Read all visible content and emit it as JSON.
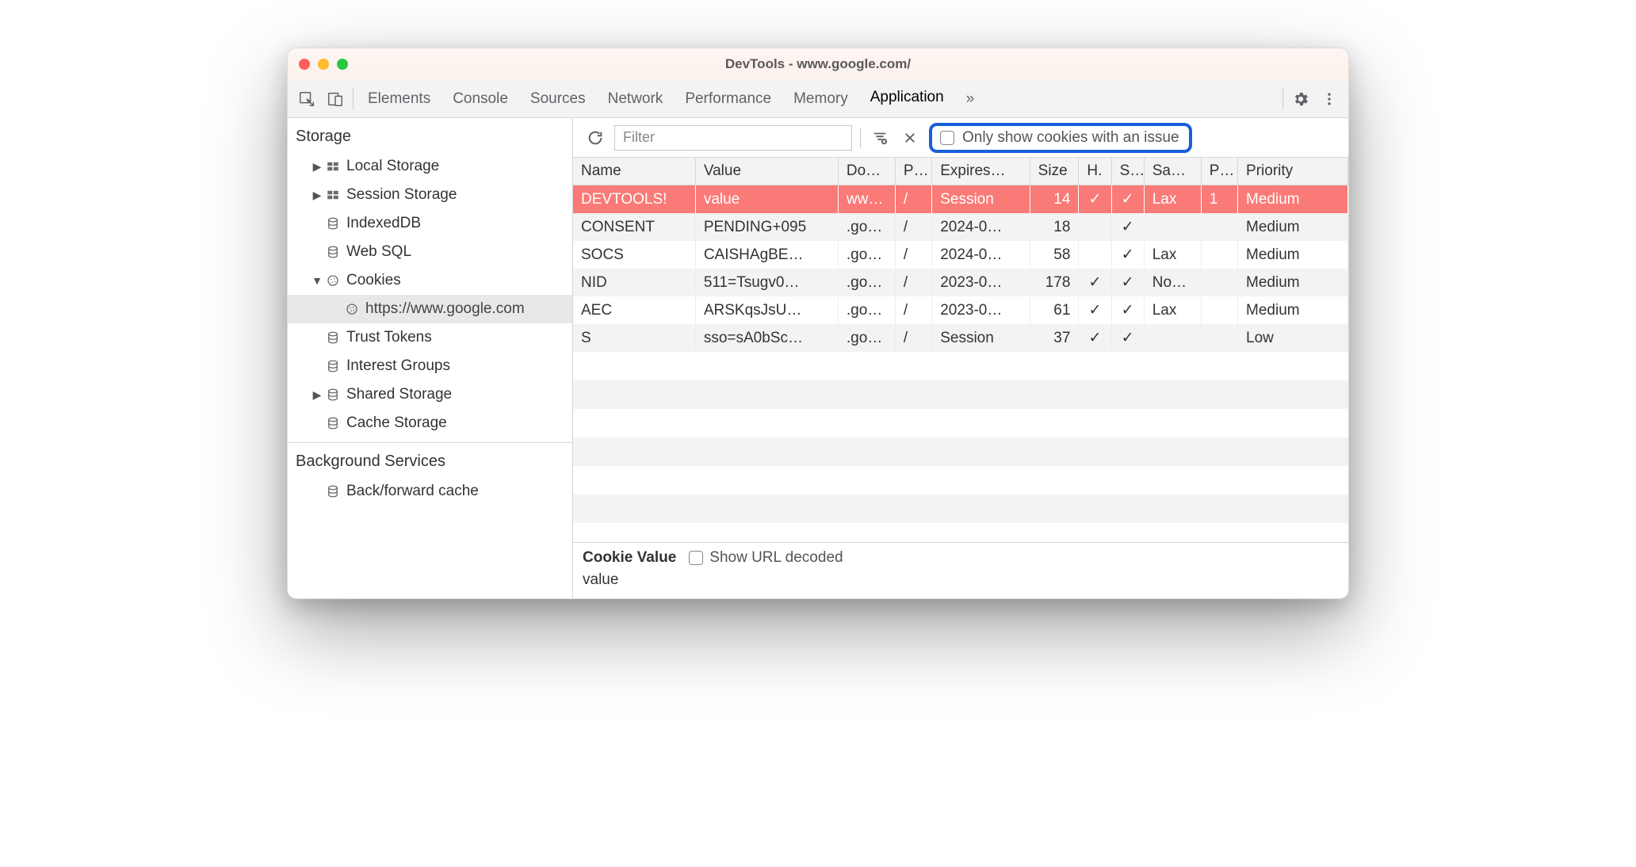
{
  "window": {
    "title": "DevTools - www.google.com/"
  },
  "tabs": {
    "items": [
      "Elements",
      "Console",
      "Sources",
      "Network",
      "Performance",
      "Memory",
      "Application"
    ],
    "active_index": 6,
    "overflow_glyph": "»"
  },
  "toolbar": {
    "filter_placeholder": "Filter",
    "only_issues_label": "Only show cookies with an issue",
    "only_issues_checked": false
  },
  "sidebar": {
    "storage_header": "Storage",
    "items": [
      {
        "label": "Local Storage",
        "icon": "grid",
        "caret": "closed"
      },
      {
        "label": "Session Storage",
        "icon": "grid",
        "caret": "closed"
      },
      {
        "label": "IndexedDB",
        "icon": "db",
        "caret": "none"
      },
      {
        "label": "Web SQL",
        "icon": "db",
        "caret": "none"
      },
      {
        "label": "Cookies",
        "icon": "cookie",
        "caret": "open"
      },
      {
        "label": "https://www.google.com",
        "icon": "cookie",
        "caret": "none",
        "indent": 2,
        "selected": true
      },
      {
        "label": "Trust Tokens",
        "icon": "db",
        "caret": "none"
      },
      {
        "label": "Interest Groups",
        "icon": "db",
        "caret": "none"
      },
      {
        "label": "Shared Storage",
        "icon": "db",
        "caret": "closed"
      },
      {
        "label": "Cache Storage",
        "icon": "db",
        "caret": "none"
      }
    ],
    "bg_header": "Background Services",
    "bg_items": [
      {
        "label": "Back/forward cache",
        "icon": "db"
      }
    ]
  },
  "table": {
    "columns": [
      "Name",
      "Value",
      "Do…",
      "P…",
      "Expires…",
      "Size",
      "H.",
      "S…",
      "Sa…",
      "P…",
      "Priority"
    ],
    "rows": [
      {
        "highlight": true,
        "name": "DEVTOOLS!",
        "value": "value",
        "domain": "ww…",
        "path": "/",
        "expires": "Session",
        "size": "14",
        "http": "✓",
        "secure": "✓",
        "samesite": "Lax",
        "partition": "1",
        "priority": "Medium"
      },
      {
        "highlight": false,
        "name": "CONSENT",
        "value": "PENDING+095",
        "domain": ".go…",
        "path": "/",
        "expires": "2024-0…",
        "size": "18",
        "http": "",
        "secure": "✓",
        "samesite": "",
        "partition": "",
        "priority": "Medium"
      },
      {
        "highlight": false,
        "name": "SOCS",
        "value": "CAISHAgBE…",
        "domain": ".go…",
        "path": "/",
        "expires": "2024-0…",
        "size": "58",
        "http": "",
        "secure": "✓",
        "samesite": "Lax",
        "partition": "",
        "priority": "Medium"
      },
      {
        "highlight": false,
        "name": "NID",
        "value": "511=Tsugv0…",
        "domain": ".go…",
        "path": "/",
        "expires": "2023-0…",
        "size": "178",
        "http": "✓",
        "secure": "✓",
        "samesite": "No…",
        "partition": "",
        "priority": "Medium"
      },
      {
        "highlight": false,
        "name": "AEC",
        "value": "ARSKqsJsU…",
        "domain": ".go…",
        "path": "/",
        "expires": "2023-0…",
        "size": "61",
        "http": "✓",
        "secure": "✓",
        "samesite": "Lax",
        "partition": "",
        "priority": "Medium"
      },
      {
        "highlight": false,
        "name": "S",
        "value": "sso=sA0bSc…",
        "domain": ".go…",
        "path": "/",
        "expires": "Session",
        "size": "37",
        "http": "✓",
        "secure": "✓",
        "samesite": "",
        "partition": "",
        "priority": "Low"
      }
    ]
  },
  "footer": {
    "label": "Cookie Value",
    "url_decoded_label": "Show URL decoded",
    "url_decoded_checked": false,
    "value": "value"
  }
}
